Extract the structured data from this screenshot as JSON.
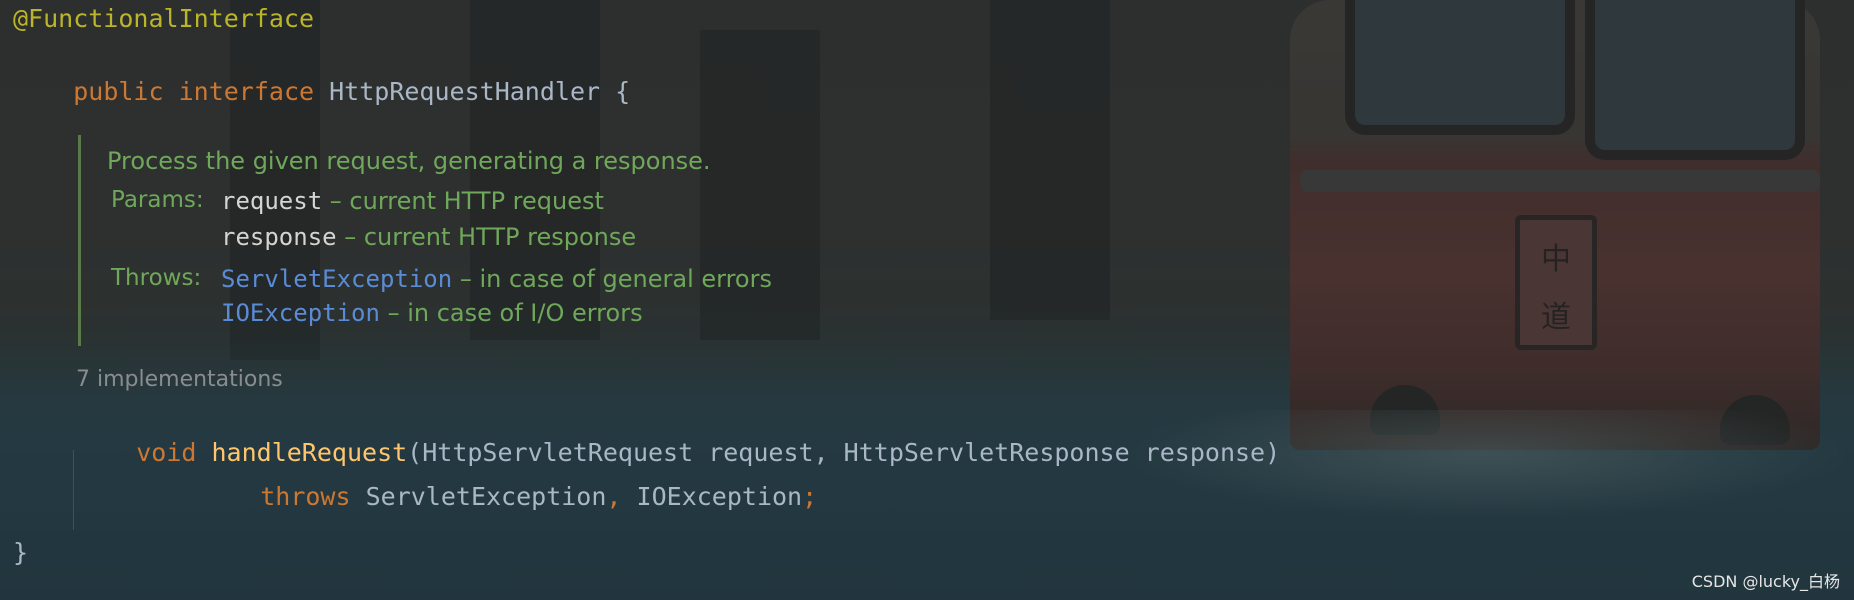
{
  "code": {
    "annotation": "@FunctionalInterface",
    "decl_public": "public",
    "decl_interface": "interface",
    "decl_name": "HttpRequestHandler",
    "decl_brace": "{",
    "doc": {
      "summary": "Process the given request, generating a response.",
      "params_tag": "Params:",
      "params": [
        {
          "name": "request",
          "desc": " – current HTTP request"
        },
        {
          "name": "response",
          "desc": " – current HTTP response"
        }
      ],
      "throws_tag": "Throws:",
      "throws": [
        {
          "name": "ServletException",
          "desc": " – in case of general errors"
        },
        {
          "name": "IOException",
          "desc": " – in case of I/O errors"
        }
      ]
    },
    "implementations_hint": "7 implementations",
    "method": {
      "return_type": "void",
      "name": "handleRequest",
      "signature": "(HttpServletRequest request, HttpServletResponse response)",
      "throws_kw": "throws",
      "exception1": "ServletException",
      "comma": ",",
      "exception2": "IOException",
      "semicolon": ";"
    },
    "closing_brace": "}"
  },
  "background": {
    "sign_glyph_top": "中",
    "sign_glyph_bottom": "道"
  },
  "watermark": "CSDN @lucky_白杨",
  "colors": {
    "annotation": "#bbb529",
    "keyword": "#cc7832",
    "identifier": "#a9b7c6",
    "method_name": "#ffc66d",
    "doc_text": "#6fa85a",
    "doc_link": "#5a8bd6"
  }
}
